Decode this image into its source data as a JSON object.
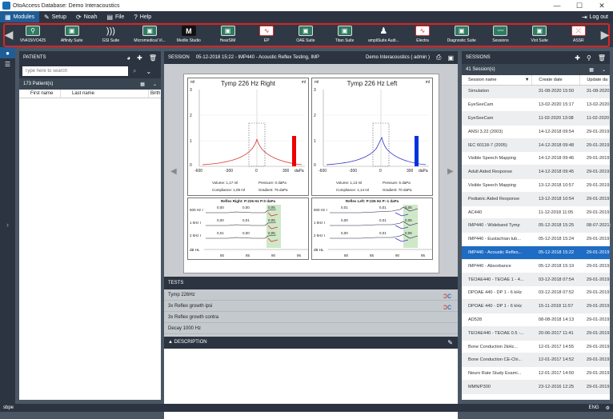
{
  "window": {
    "title": "OtoAccess Database: Demo Interacoustics",
    "min": "—",
    "max": "☐",
    "close": "✕"
  },
  "menu": [
    {
      "label": "Modules",
      "icon": "▦"
    },
    {
      "label": "Setup",
      "icon": "✎"
    },
    {
      "label": "Noah",
      "icon": "⟳"
    },
    {
      "label": "File",
      "icon": "▤"
    },
    {
      "label": "Help",
      "icon": "?"
    }
  ],
  "logout": {
    "label": "Log out",
    "icon": "⇥"
  },
  "modules": [
    {
      "label": "VN415/VO425",
      "icon": "⚲",
      "style": "green"
    },
    {
      "label": "Affinity Suite",
      "icon": "▣",
      "style": "green"
    },
    {
      "label": "GSI Suite",
      "icon": ")))",
      "style": "plain"
    },
    {
      "label": "Micromedical Vi...",
      "icon": "▣",
      "style": "green"
    },
    {
      "label": "Medlix Studio",
      "icon": "M",
      "style": "dark"
    },
    {
      "label": "HearSIM",
      "icon": "▣",
      "style": "green"
    },
    {
      "label": "EP",
      "icon": "∿",
      "style": "red"
    },
    {
      "label": "OAE Suite",
      "icon": "▣",
      "style": "green"
    },
    {
      "label": "Titan Suite",
      "icon": "▣",
      "style": "green"
    },
    {
      "label": "ampliSuite Audi...",
      "icon": "♟",
      "style": "plain"
    },
    {
      "label": "Electra",
      "icon": "∿",
      "style": "red"
    },
    {
      "label": "Diagnostic Suite",
      "icon": "▣",
      "style": "green"
    },
    {
      "label": "Sessions",
      "icon": "〰",
      "style": "green"
    },
    {
      "label": "Viot Suite",
      "icon": "▣",
      "style": "green"
    },
    {
      "label": "ASSR",
      "icon": "⤫",
      "style": "red"
    }
  ],
  "patients": {
    "title": "PATIENTS",
    "search_placeholder": "Type here to search",
    "count": "173 Patient(s)",
    "columns": [
      "First name",
      "Last name",
      "Birth"
    ]
  },
  "session": {
    "title": "SESSION",
    "date": "05-12-2018 15:22 - IMP440 - Acoustic Reflex Testing, IMP",
    "user": "Demo Interacoustics ( admin )"
  },
  "report": {
    "right": {
      "title": "Tymp 226 Hz Right",
      "unit": "ml",
      "yticks": [
        "3",
        "2",
        "1",
        "0"
      ],
      "xticks": [
        "-600",
        "-300",
        "0",
        "300",
        "daPa"
      ],
      "volume": "Volume: 1,17 ml",
      "pressure": "Pressure: 0 daPa",
      "compliance": "Compliance: 1,09 ml",
      "gradient": "Gradient: 79 daPa",
      "reflex_title": "Reflex Right: P:226 Hz P:0 daPa",
      "rows": [
        "500 Hz I",
        "1 kHz I",
        "2 kHz I",
        "dB HL"
      ],
      "vals": [
        [
          "0,00",
          "0,00",
          "0,05"
        ],
        [
          "0,00",
          "0,01",
          "0,05"
        ],
        [
          "0,01",
          "0,00",
          "0,05"
        ]
      ],
      "xt": [
        "80",
        "85",
        "90",
        "95"
      ]
    },
    "left": {
      "title": "Tymp 226 Hz Left",
      "unit": "ml",
      "yticks": [
        "3",
        "2",
        "1",
        "0"
      ],
      "xticks": [
        "-600",
        "-300",
        "0",
        "300",
        "daPa"
      ],
      "volume": "Volume: 1,13 ml",
      "pressure": "Pressure: 5 daPa",
      "compliance": "Compliance: 1,14 ml",
      "gradient": "Gradient: 70 daPa",
      "reflex_title": "Reflex Left: P:226 Hz P:-1 daPa",
      "rows": [
        "500 Hz I",
        "1 kHz I",
        "2 kHz I",
        "dB HL"
      ],
      "vals": [
        [
          "0,01",
          "0,01",
          "0,05"
        ],
        [
          "0,00",
          "0,01",
          "0,05"
        ],
        [
          "0,00",
          "0,01",
          "0,05"
        ]
      ],
      "xt": [
        "80",
        "85",
        "90",
        "95"
      ]
    }
  },
  "tests": {
    "title": "TESTS",
    "items": [
      "Tymp 226Hz",
      "3x Reflex growth ipsi",
      "3x Reflex growth contra",
      "Decay 1000 Hz"
    ]
  },
  "description": {
    "title": "DESCRIPTION"
  },
  "sessions": {
    "title": "SESSIONS",
    "count": "41 Session(s)",
    "columns": [
      "Session name",
      "Create date",
      "Update da"
    ],
    "rows": [
      [
        "Simulation",
        "31-08-2020 15:50",
        "31-08-2020"
      ],
      [
        "EyeSeeCam",
        "13-02-2020 15:17",
        "13-02-2020"
      ],
      [
        "EyeSeeCam",
        "11-02-2020 13:08",
        "11-02-2020"
      ],
      [
        "ANSI 3.22 (2003)",
        "14-12-2018 09:54",
        "29-01-2019"
      ],
      [
        "IEC 60118-7 (2005)",
        "14-12-2018 09:48",
        "29-01-2019"
      ],
      [
        "Visible Speech Mapping",
        "14-12-2018 09:46",
        "29-01-2019"
      ],
      [
        "Adult Aided Response",
        "14-12-2018 09:45",
        "29-01-2019"
      ],
      [
        "Visible Speech Mapping",
        "13-12-2018 10:57",
        "29-01-2019"
      ],
      [
        "Pediatric Aided Response",
        "13-12-2018 10:54",
        "29-01-2019"
      ],
      [
        "AC440",
        "11-12-2018 11:05",
        "29-01-2019"
      ],
      [
        "IMP440 - Wideband Tymp",
        "05-12-2018 15:25",
        "08-07-2021"
      ],
      [
        "IMP440 - Eustachian tub...",
        "05-12-2018 15:24",
        "29-01-2019"
      ],
      [
        "IMP440 - Acoustic Reflex...",
        "05-12-2018 15:22",
        "29-01-2019"
      ],
      [
        "IMP440 - Absorbance",
        "05-12-2018 15:19",
        "29-01-2019"
      ],
      [
        "TEOAE440 - TEOAE 1 - 4...",
        "03-12-2018 07:54",
        "29-01-2019"
      ],
      [
        "DPOAE 440 - DP 1 - 6 kHz",
        "03-12-2018 07:52",
        "29-01-2019"
      ],
      [
        "DPOAE 440 - DP 1 - 6 kHz",
        "15-11-2018 11:57",
        "29-01-2019"
      ],
      [
        "AD528",
        "08-08-2018 14:13",
        "29-01-2019"
      ],
      [
        "TEOAE440 - TEOAE 0.5 -...",
        "20-06-2017 11:41",
        "29-01-2019"
      ],
      [
        "Bone Conduction 2kHz...",
        "12-01-2017 14:55",
        "29-01-2019"
      ],
      [
        "Bone Conduction CE-Chi...",
        "12-01-2017 14:52",
        "29-01-2019"
      ],
      [
        "Neuro Rate Study Exami...",
        "12-01-2017 14:50",
        "29-01-2019"
      ],
      [
        "MMN/P300",
        "23-12-2016 12:25",
        "29-01-2019"
      ]
    ],
    "selected_index": 12
  },
  "status": {
    "user": "sbpe",
    "lang": "ENG"
  },
  "colors": {
    "accent": "#1f5d96",
    "header": "#2b3440",
    "selected": "#1f6cc4",
    "frame": "#dd2222"
  }
}
